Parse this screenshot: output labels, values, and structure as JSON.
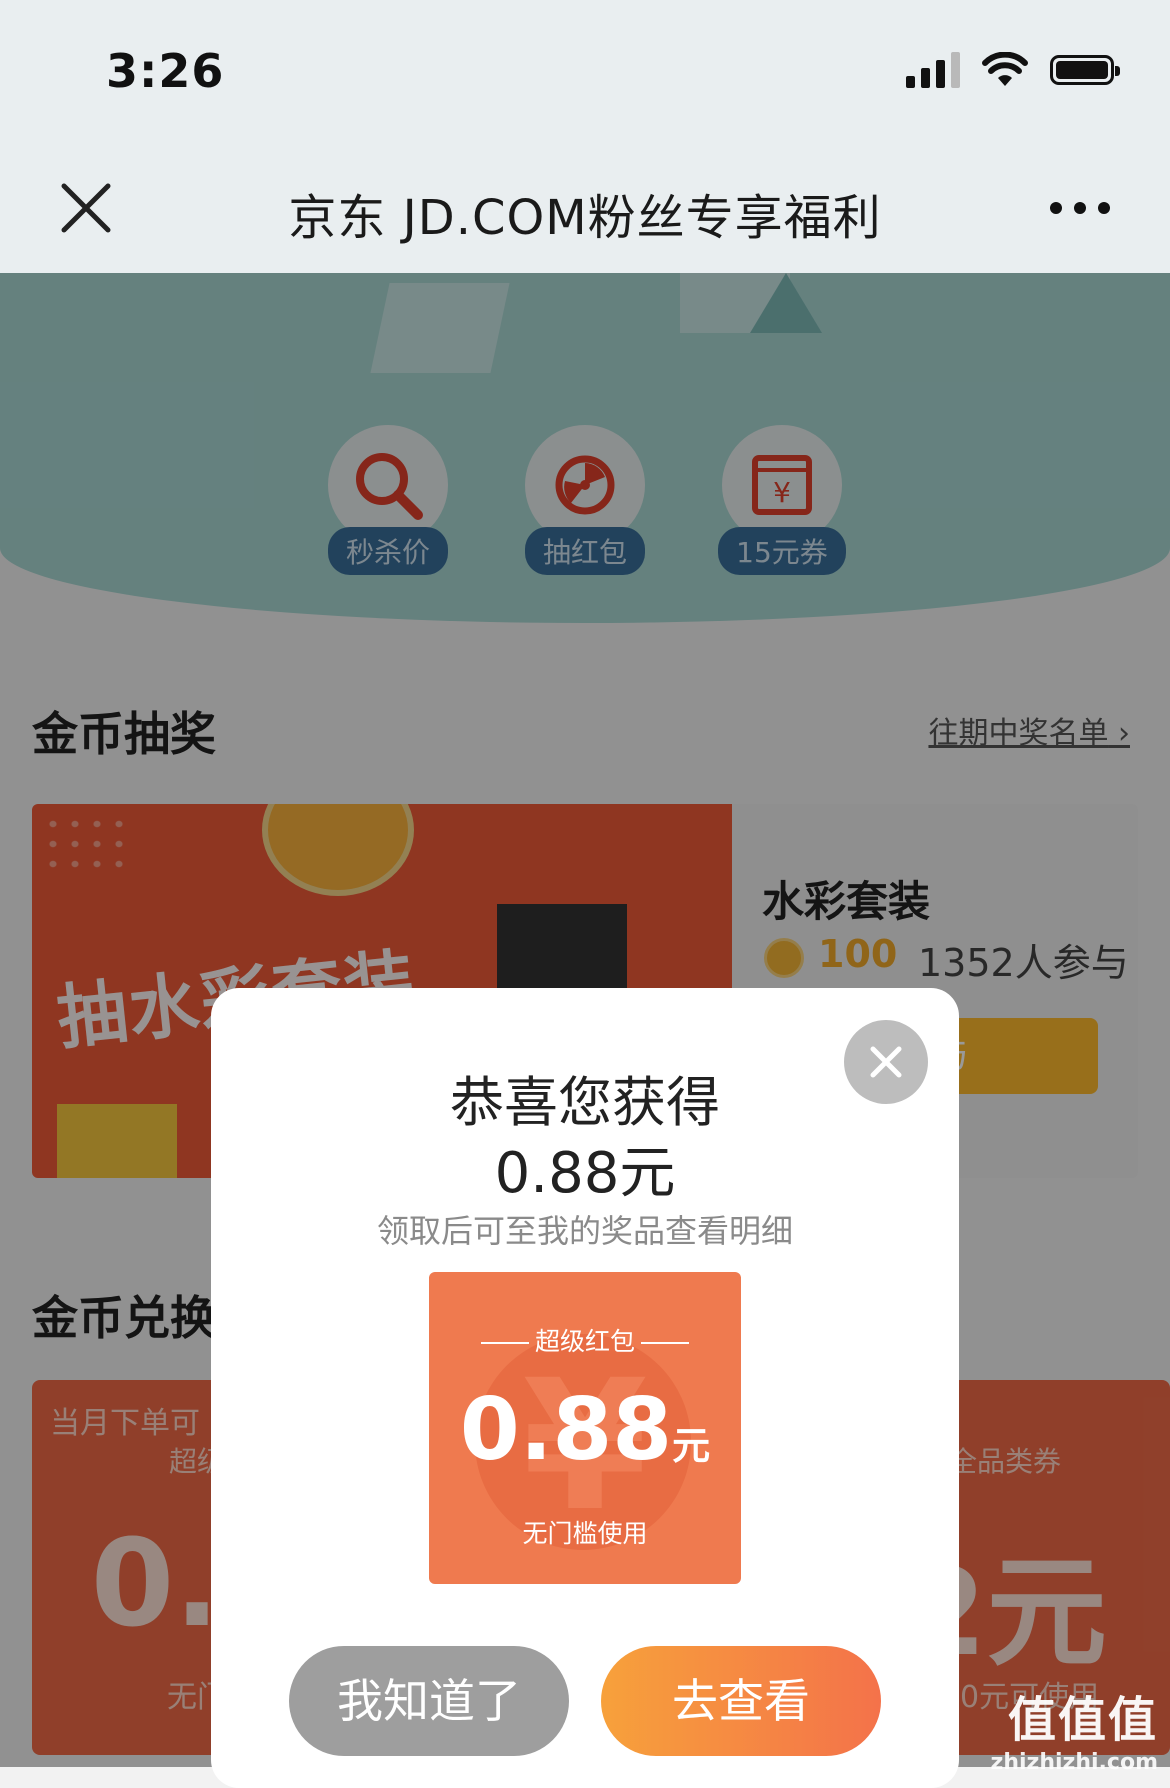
{
  "status_bar": {
    "time": "3:26"
  },
  "nav": {
    "title": "京东 JD.COM粉丝专享福利"
  },
  "hero": {
    "items": [
      {
        "label": "秒杀价",
        "icon": "magnifier-icon"
      },
      {
        "label": "抽红包",
        "icon": "wheel-icon"
      },
      {
        "label": "15元券",
        "icon": "coupon-yen-icon"
      }
    ]
  },
  "lottery": {
    "section_title": "金币抽奖",
    "winners_link": "往期中奖名单",
    "card": {
      "image_caption": "抽水彩套装",
      "title": "水彩套装",
      "cost": "100",
      "participants": "1352人参与",
      "join_label": "参与"
    }
  },
  "exchange": {
    "section_title": "金币兑换",
    "cards": [
      {
        "tag": "当月下单可",
        "type": "超级",
        "value": "0.8",
        "sub": "无门"
      },
      {
        "tag": "",
        "type": "全品类券",
        "value": "2元",
        "sub": "满50元可使用"
      }
    ]
  },
  "modal": {
    "title": "恭喜您获得",
    "amount": "0.88元",
    "hint": "领取后可至我的奖品查看明细",
    "coupon": {
      "type": "超级红包",
      "value": "0.88",
      "unit": "元",
      "note": "无门槛使用"
    },
    "ok_label": "我知道了",
    "view_label": "去查看"
  },
  "watermark": {
    "main": "值值值",
    "sub": "zhizhizhi.com"
  },
  "colors": {
    "accent_orange": "#f4724a",
    "coupon_orange": "#ef7a4f",
    "gold": "#f0a92a"
  }
}
